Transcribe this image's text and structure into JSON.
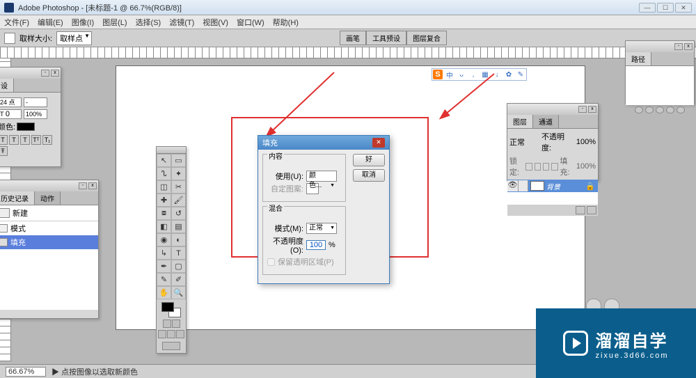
{
  "titlebar": {
    "app": "Adobe Photoshop",
    "doc": "[未标题-1 @ 66.7%(RGB/8)]"
  },
  "menu": [
    "文件(F)",
    "编辑(E)",
    "图像(I)",
    "图层(L)",
    "选择(S)",
    "滤镜(T)",
    "视图(V)",
    "窗口(W)",
    "帮助(H)"
  ],
  "options": {
    "label": "取样大小:",
    "value": "取样点"
  },
  "doc_tabs": [
    "画笔",
    "工具预设",
    "图层复合"
  ],
  "char": {
    "size": "24 点",
    "leading": "-",
    "track": "0",
    "scale": "100%",
    "color_label": "颜色:"
  },
  "history": {
    "tabs": [
      "历史记录",
      "动作"
    ],
    "doc": "新建",
    "items": [
      {
        "label": "模式",
        "sel": false
      },
      {
        "label": "填充",
        "sel": true
      }
    ]
  },
  "ime": {
    "brand": "S",
    "chars": [
      "中",
      "ᴗ",
      ",",
      "▦",
      "↓",
      "✿",
      "✎"
    ]
  },
  "layers": {
    "tabs": [
      "图层",
      "通道"
    ],
    "mode": "正常",
    "opacity_label": "不透明度:",
    "opacity": "100%",
    "lock_label": "锁定:",
    "fill_label": "填充:",
    "fill": "100%",
    "layer_name": "背景"
  },
  "paths": {
    "tab": "路径"
  },
  "dialog": {
    "title": "填充",
    "content_group": "内容",
    "use_label": "使用(U):",
    "use_value": "颜色...",
    "pattern_label": "自定图案:",
    "blend_group": "混合",
    "mode_label": "模式(M):",
    "mode_value": "正常",
    "opacity_label": "不透明度(O):",
    "opacity_value": "100",
    "percent": "%",
    "preserve": "保留透明区域(P)",
    "ok": "好",
    "cancel": "取消"
  },
  "status": {
    "zoom": "66.67%",
    "hint": "▶ 点按图像以选取新颜色"
  },
  "watermark": {
    "big": "溜溜自学",
    "small": "zixue.3d66.com"
  }
}
